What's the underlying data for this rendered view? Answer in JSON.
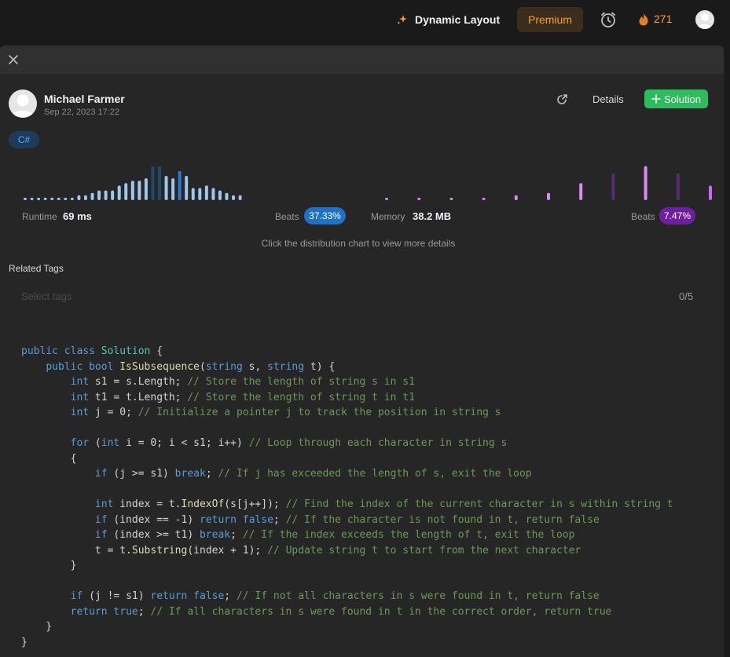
{
  "topbar": {
    "dynamic_layout": "Dynamic Layout",
    "premium": "Premium",
    "streak_count": "271"
  },
  "submission": {
    "author": "Michael Farmer",
    "date": "Sep 22, 2023 17:22",
    "details_label": "Details",
    "solution_label": "Solution",
    "language": "C#"
  },
  "stats": {
    "runtime_label": "Runtime",
    "runtime_value": "69 ms",
    "runtime_beats_label": "Beats",
    "runtime_beats": "37.33%",
    "memory_label": "Memory",
    "memory_value": "38.2 MB",
    "memory_beats_label": "Beats",
    "memory_beats": "7.47%",
    "hint": "Click the distribution chart to view more details"
  },
  "tags": {
    "title": "Related Tags",
    "placeholder": "Select tags",
    "count": "0/5"
  },
  "colors": {
    "runtime_bar": "#9fc7ec",
    "runtime_bar_dark": "#1f4770",
    "runtime_bar_active": "#2a7ad1",
    "memory_bar": "#d78df0",
    "memory_bar_dark": "#5c2a70",
    "memory_bar_active": "#c86af0",
    "runtime_badge": "#1d72c8",
    "memory_badge": "#6e1fa0",
    "accent_green": "#2cbb5d",
    "premium": "#ffa116"
  },
  "chart_data": [
    {
      "type": "bar",
      "title": "Runtime",
      "values": [
        1,
        1,
        1,
        1,
        1,
        1,
        1,
        1,
        2,
        2,
        3,
        4,
        4,
        4,
        6,
        7,
        8,
        8,
        9,
        14,
        14,
        10,
        9,
        12,
        10,
        5,
        5,
        6,
        5,
        4,
        3,
        2,
        2
      ],
      "highlight_index": 23,
      "dark_indices": [
        19,
        20
      ]
    },
    {
      "type": "bar",
      "title": "Memory",
      "values": [
        1,
        1,
        1,
        1,
        2,
        3,
        7,
        11,
        14,
        11,
        6
      ],
      "highlight_index": 10,
      "dark_indices": [
        7,
        9
      ]
    }
  ],
  "code_lines": [
    [
      [
        "kw",
        "public class "
      ],
      [
        "ty",
        "Solution"
      ],
      [
        "pl",
        " {"
      ]
    ],
    [
      [
        "pl",
        "    "
      ],
      [
        "kw",
        "public bool "
      ],
      [
        "fn",
        "IsSubsequence"
      ],
      [
        "pl",
        "("
      ],
      [
        "kw",
        "string"
      ],
      [
        "pl",
        " s, "
      ],
      [
        "kw",
        "string"
      ],
      [
        "pl",
        " t) {"
      ]
    ],
    [
      [
        "pl",
        "        "
      ],
      [
        "kw",
        "int"
      ],
      [
        "pl",
        " s1 = s.Length; "
      ],
      [
        "cm",
        "// Store the length of string s in s1"
      ]
    ],
    [
      [
        "pl",
        "        "
      ],
      [
        "kw",
        "int"
      ],
      [
        "pl",
        " t1 = t.Length; "
      ],
      [
        "cm",
        "// Store the length of string t in t1"
      ]
    ],
    [
      [
        "pl",
        "        "
      ],
      [
        "kw",
        "int"
      ],
      [
        "pl",
        " j = 0; "
      ],
      [
        "cm",
        "// Initialize a pointer j to track the position in string s"
      ]
    ],
    [
      [
        "pl",
        ""
      ]
    ],
    [
      [
        "pl",
        "        "
      ],
      [
        "kw",
        "for"
      ],
      [
        "pl",
        " ("
      ],
      [
        "kw",
        "int"
      ],
      [
        "pl",
        " i = 0; i < s1; i++) "
      ],
      [
        "cm",
        "// Loop through each character in string s"
      ]
    ],
    [
      [
        "pl",
        "        {"
      ]
    ],
    [
      [
        "pl",
        "            "
      ],
      [
        "kw",
        "if"
      ],
      [
        "pl",
        " (j >= s1) "
      ],
      [
        "kw",
        "break"
      ],
      [
        "pl",
        "; "
      ],
      [
        "cm",
        "// If j has exceeded the length of s, exit the loop"
      ]
    ],
    [
      [
        "pl",
        ""
      ]
    ],
    [
      [
        "pl",
        "            "
      ],
      [
        "kw",
        "int"
      ],
      [
        "pl",
        " index = t."
      ],
      [
        "fn",
        "IndexOf"
      ],
      [
        "pl",
        "(s[j++]); "
      ],
      [
        "cm",
        "// Find the index of the current character in s within string t"
      ]
    ],
    [
      [
        "pl",
        "            "
      ],
      [
        "kw",
        "if"
      ],
      [
        "pl",
        " (index == -1) "
      ],
      [
        "kw",
        "return false"
      ],
      [
        "pl",
        "; "
      ],
      [
        "cm",
        "// If the character is not found in t, return false"
      ]
    ],
    [
      [
        "pl",
        "            "
      ],
      [
        "kw",
        "if"
      ],
      [
        "pl",
        " (index >= t1) "
      ],
      [
        "kw",
        "break"
      ],
      [
        "pl",
        "; "
      ],
      [
        "cm",
        "// If the index exceeds the length of t, exit the loop"
      ]
    ],
    [
      [
        "pl",
        "            t = t."
      ],
      [
        "fn",
        "Substring"
      ],
      [
        "pl",
        "(index + 1); "
      ],
      [
        "cm",
        "// Update string t to start from the next character"
      ]
    ],
    [
      [
        "pl",
        "        }"
      ]
    ],
    [
      [
        "pl",
        ""
      ]
    ],
    [
      [
        "pl",
        "        "
      ],
      [
        "kw",
        "if"
      ],
      [
        "pl",
        " (j != s1) "
      ],
      [
        "kw",
        "return false"
      ],
      [
        "pl",
        "; "
      ],
      [
        "cm",
        "// If not all characters in s were found in t, return false"
      ]
    ],
    [
      [
        "pl",
        "        "
      ],
      [
        "kw",
        "return true"
      ],
      [
        "pl",
        "; "
      ],
      [
        "cm",
        "// If all characters in s were found in t in the correct order, return true"
      ]
    ],
    [
      [
        "pl",
        "    }"
      ]
    ],
    [
      [
        "pl",
        "}"
      ]
    ]
  ]
}
